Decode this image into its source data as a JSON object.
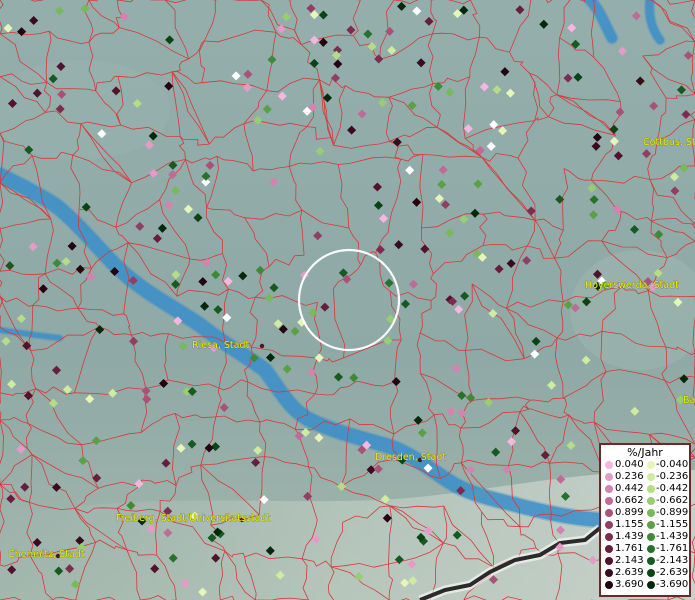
{
  "map": {
    "river_color": "#3c8fc9",
    "border_color": "#d83838",
    "cities": [
      {
        "name": "Cottbus, St"
      },
      {
        "name": "Hoyerswerda, Stadt"
      },
      {
        "name": "Riesa, Stadt"
      },
      {
        "name": "Dresden, Stadt"
      },
      {
        "name": "Freiberg, Stadt/Universitatsstadt"
      },
      {
        "name": "Chemnitz, Stadt"
      },
      {
        "name": "Ba"
      }
    ]
  },
  "legend": {
    "title": "%/Jahr",
    "rows": [
      {
        "pos": "0.040",
        "neg": "-0.040",
        "pos_color": "#f7b6e0",
        "neg_color": "#e6f5b8"
      },
      {
        "pos": "0.236",
        "neg": "-0.236",
        "pos_color": "#e59bc7",
        "neg_color": "#cfeba0"
      },
      {
        "pos": "0.442",
        "neg": "-0.442",
        "pos_color": "#d482b0",
        "neg_color": "#b4dd86"
      },
      {
        "pos": "0.662",
        "neg": "-0.662",
        "pos_color": "#c06a98",
        "neg_color": "#98cd70"
      },
      {
        "pos": "0.899",
        "neg": "-0.899",
        "pos_color": "#a85278",
        "neg_color": "#78b95a"
      },
      {
        "pos": "1.155",
        "neg": "-1.155",
        "pos_color": "#923e62",
        "neg_color": "#5aa146"
      },
      {
        "pos": "1.439",
        "neg": "-1.439",
        "pos_color": "#7c2c4e",
        "neg_color": "#3f8a36"
      },
      {
        "pos": "1.761",
        "neg": "-1.761",
        "pos_color": "#661e3c",
        "neg_color": "#27722a"
      },
      {
        "pos": "2.143",
        "neg": "-2.143",
        "pos_color": "#50122c",
        "neg_color": "#165a1f"
      },
      {
        "pos": "2.639",
        "neg": "-2.639",
        "pos_color": "#3a0a1e",
        "neg_color": "#0a4414"
      },
      {
        "pos": "3.690",
        "neg": "-3.690",
        "pos_color": "#240410",
        "neg_color": "#03280a"
      }
    ]
  }
}
